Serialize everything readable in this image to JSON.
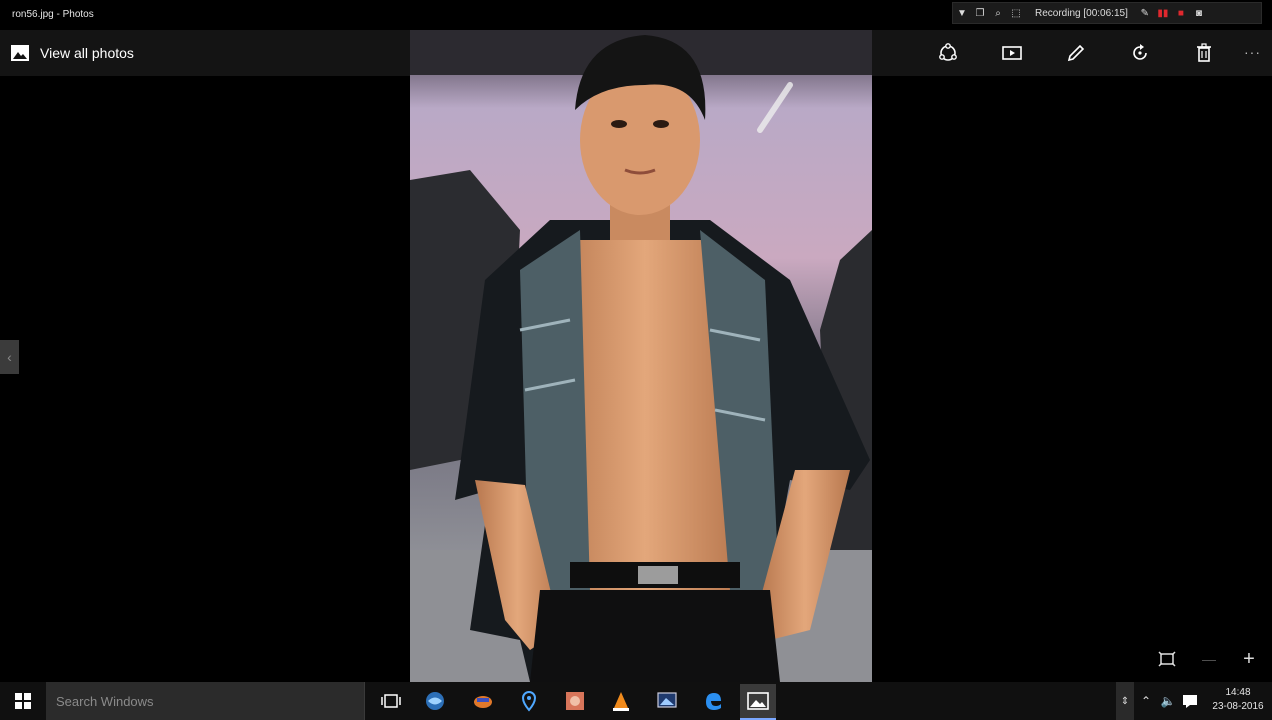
{
  "window": {
    "title": "ron56.jpg - Photos"
  },
  "recorder": {
    "label": "Recording [00:06:15]"
  },
  "appbar": {
    "back_label": "View all photos",
    "tools": [
      "share-icon",
      "slideshow-icon",
      "edit-icon",
      "rotate-icon",
      "delete-icon"
    ],
    "more_label": "···"
  },
  "photo": {
    "description_icon": "portrait-photo"
  },
  "zoom": {
    "minus": "—",
    "plus": "+"
  },
  "taskbar": {
    "search_placeholder": "Search Windows",
    "clock_time": "14:48",
    "clock_date": "23-08-2016"
  },
  "colors": {
    "accent": "#7aa7ff",
    "record_red": "#e0282e"
  }
}
